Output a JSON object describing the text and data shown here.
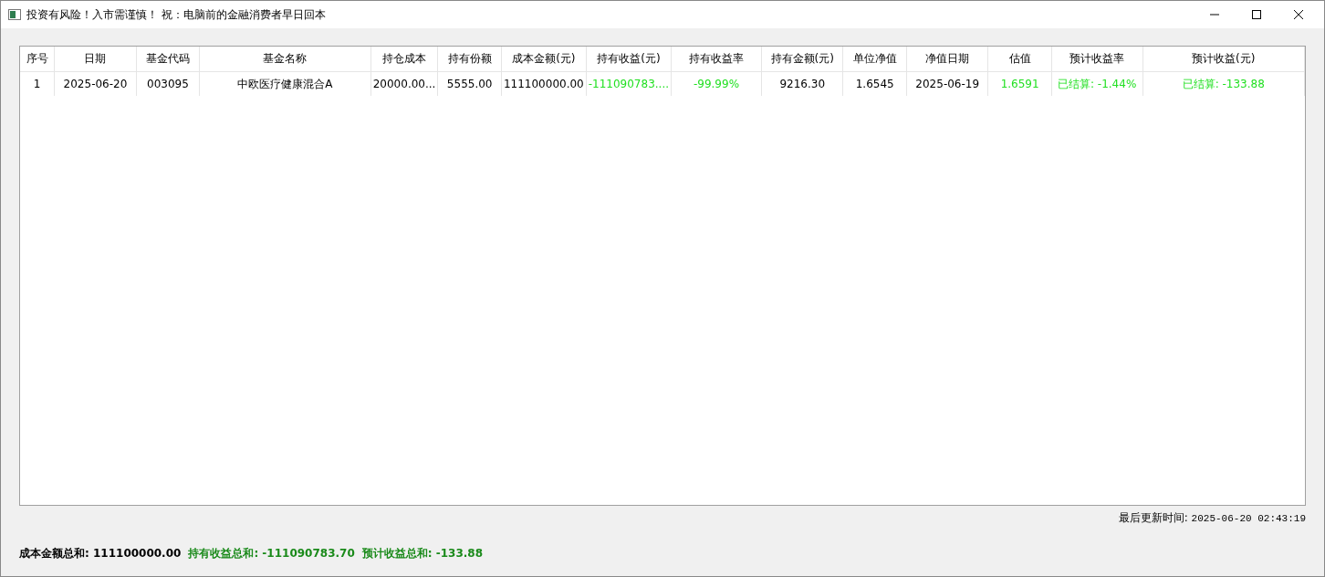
{
  "window": {
    "title": "投资有风险！入市需谨慎！ 祝：电脑前的金融消费者早日回本"
  },
  "table": {
    "columns": [
      {
        "label": "序号"
      },
      {
        "label": "日期"
      },
      {
        "label": "基金代码"
      },
      {
        "label": "基金名称"
      },
      {
        "label": "持仓成本"
      },
      {
        "label": "持有份额"
      },
      {
        "label": "成本金额(元)"
      },
      {
        "label": "持有收益(元)"
      },
      {
        "label": "持有收益率"
      },
      {
        "label": "持有金额(元)"
      },
      {
        "label": "单位净值"
      },
      {
        "label": "净值日期"
      },
      {
        "label": "估值"
      },
      {
        "label": "预计收益率"
      },
      {
        "label": "预计收益(元)"
      }
    ],
    "rows": [
      {
        "cells": [
          {
            "text": "1",
            "kind": "plain"
          },
          {
            "text": "2025-06-20",
            "kind": "plain"
          },
          {
            "text": "003095",
            "kind": "plain"
          },
          {
            "text": "中欧医疗健康混合A",
            "kind": "plain"
          },
          {
            "text": "20000.00...",
            "kind": "plain"
          },
          {
            "text": "5555.00",
            "kind": "plain"
          },
          {
            "text": "111100000.00",
            "kind": "plain"
          },
          {
            "text": "-111090783....",
            "kind": "gain"
          },
          {
            "text": "-99.99%",
            "kind": "gain"
          },
          {
            "text": "9216.30",
            "kind": "plain"
          },
          {
            "text": "1.6545",
            "kind": "plain"
          },
          {
            "text": "2025-06-19",
            "kind": "plain"
          },
          {
            "text": "1.6591",
            "kind": "gain"
          },
          {
            "text": "已结算: -1.44%",
            "kind": "gain"
          },
          {
            "text": "已结算: -133.88",
            "kind": "gain"
          }
        ]
      }
    ]
  },
  "last_update": {
    "label": "最后更新时间:",
    "value": "2025-06-20 02:43:19"
  },
  "summary": [
    {
      "text": "成本金额总和: 111100000.00",
      "kind": "plain"
    },
    {
      "text": "持有收益总和: -111090783.70",
      "kind": "gain"
    },
    {
      "text": "预计收益总和: -133.88",
      "kind": "gain"
    }
  ]
}
